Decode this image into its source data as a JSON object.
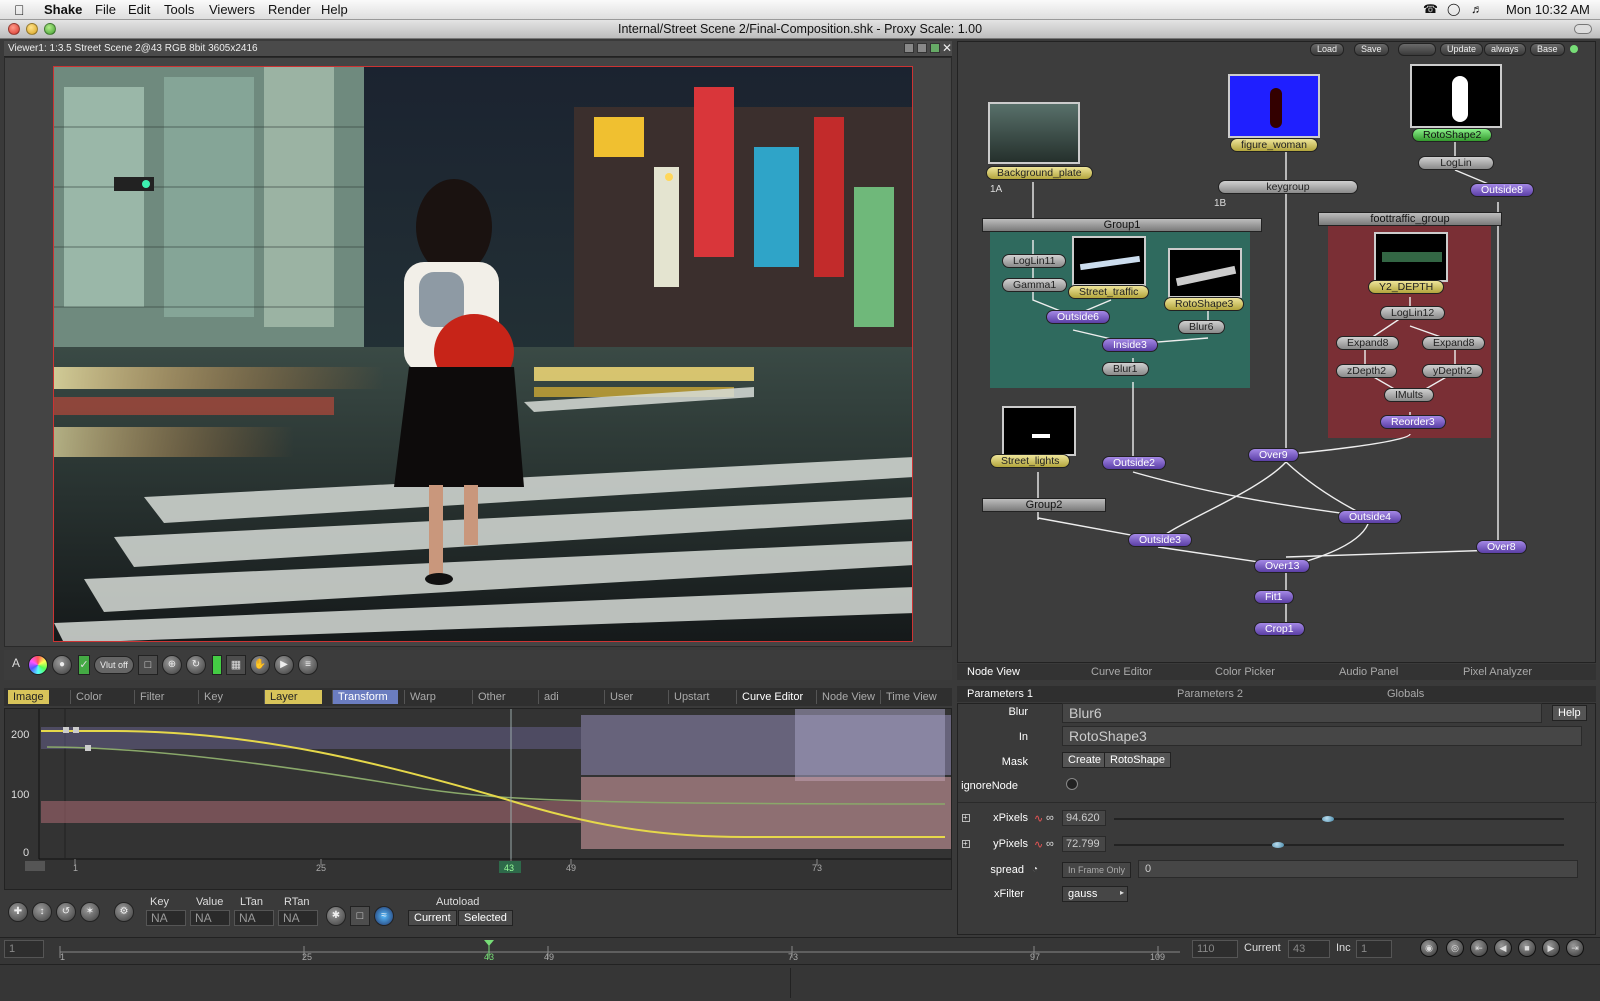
{
  "menubar": {
    "apple": "",
    "app": "Shake",
    "items": [
      "File",
      "Edit",
      "Tools",
      "Viewers",
      "Render",
      "Help"
    ],
    "clock": "Mon 10:32 AM"
  },
  "window": {
    "title": "Internal/Street Scene 2/Final-Composition.shk - Proxy Scale: 1.00"
  },
  "viewer": {
    "header": "Viewer1: 1:3.5 Street Scene 2@43 RGB 8bit 3605x2416",
    "toolbar": {
      "a_label": "A",
      "vlut_label": "Vlut off"
    }
  },
  "tool_tabs": [
    "Image",
    "Color",
    "Filter",
    "Key",
    "Layer",
    "Transform",
    "Warp",
    "Other",
    "adi",
    "User",
    "Upstart",
    "Curve Editor",
    "Node View",
    "Time View"
  ],
  "curve_editor": {
    "y_labels": [
      "200",
      "100",
      "0"
    ],
    "x_ticks": [
      "1",
      "25",
      "43",
      "49",
      "73"
    ],
    "controls": {
      "key_label": "Key",
      "value_label": "Value",
      "ltan_label": "LTan",
      "rtan_label": "RTan",
      "key": "NA",
      "value": "NA",
      "ltan": "NA",
      "rtan": "NA",
      "autoload_label": "Autoload",
      "current_btn": "Current",
      "selected_btn": "Selected"
    },
    "colors": {
      "yellow_curve": "#e6d84a",
      "green_curve": "#8aa86a",
      "waveform_blue": "#a9a3d8",
      "waveform_pink": "#d8a0a6"
    }
  },
  "node_toolbar": [
    "Load",
    "Save",
    "",
    "Update",
    "always",
    "Base"
  ],
  "nodes": {
    "background_plate": "Background_plate",
    "label_1a": "1A",
    "figure_woman": "figure_woman",
    "keygroup": "keygroup",
    "label_1b": "1B",
    "rotoshape2": "RotoShape2",
    "login_top": "LogLin",
    "outside8": "Outside8",
    "group1": "Group1",
    "loglin11": "LogLin11",
    "gamma1": "Gamma1",
    "street_traffic": "Street_traffic",
    "outside6": "Outside6",
    "rotoshape3": "RotoShape3",
    "blur6": "Blur6",
    "inside3": "Inside3",
    "blur1": "Blur1",
    "foottraffic_group": "foottraffic_group",
    "y2_depth": "Y2_DEPTH",
    "loglin12": "LogLin12",
    "expand8a": "Expand8",
    "expand8b": "Expand8",
    "zdepth2": "zDepth2",
    "ydepth2": "yDepth2",
    "imults": "IMults",
    "reorder3": "Reorder3",
    "street_lights": "Street_lights",
    "outside2": "Outside2",
    "over9": "Over9",
    "group2": "Group2",
    "outside4": "Outside4",
    "outside3": "Outside3",
    "over8": "Over8",
    "over13": "Over13",
    "fit1": "Fit1",
    "crop1": "Crop1"
  },
  "view_tabs": [
    "Node View",
    "Curve Editor",
    "Color Picker",
    "Audio Panel",
    "Pixel Analyzer"
  ],
  "param_tabs": [
    "Parameters 1",
    "Parameters 2",
    "Globals"
  ],
  "parameters": {
    "blur_label": "Blur",
    "blur_value": "Blur6",
    "help_btn": "Help",
    "in_label": "In",
    "in_value": "RotoShape3",
    "mask_label": "Mask",
    "mask_create": "Create",
    "mask_type": "RotoShape",
    "ignorenode_label": "ignoreNode",
    "xpixels_label": "xPixels",
    "xpixels_value": "94.620",
    "ypixels_label": "yPixels",
    "ypixels_value": "72.799",
    "spread_label": "spread",
    "spread_mode": "In Frame Only",
    "spread_value": "0",
    "xfilter_label": "xFilter",
    "xfilter_value": "gauss"
  },
  "timeline": {
    "start": "1",
    "end": "110",
    "current_label": "Current",
    "current": "43",
    "inc_label": "Inc",
    "inc": "1",
    "ticks": [
      "1",
      "25",
      "43",
      "49",
      "73",
      "97",
      "109"
    ]
  }
}
